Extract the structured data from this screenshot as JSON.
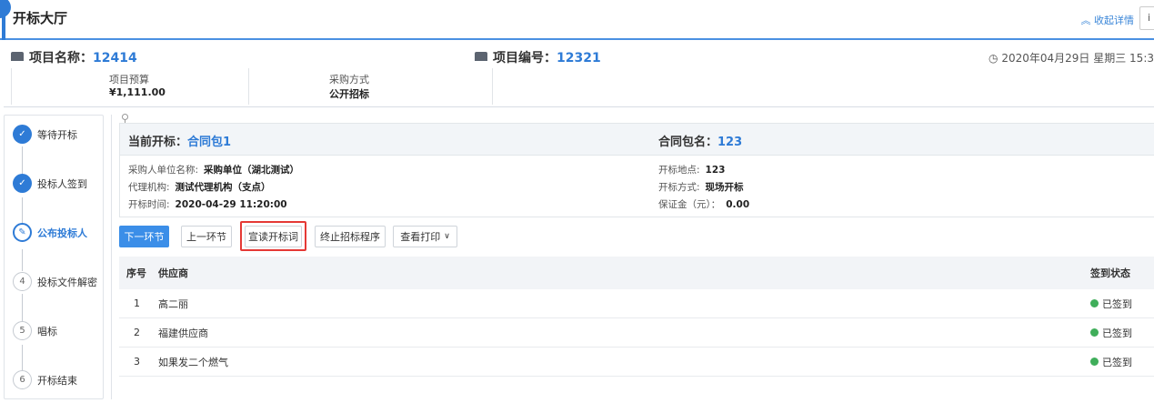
{
  "header": {
    "title": "开标大厅",
    "collapse_label": "收起详情",
    "collapse_icon": "chevron-up-icon",
    "right_button_label": "i"
  },
  "project": {
    "name_label": "项目名称：",
    "name_value": "12414",
    "code_label": "项目编号：",
    "code_value": "12321",
    "datetime": "2020年04月29日 星期三 15:3",
    "clock_icon": "clock-icon",
    "budget_label": "项目预算",
    "budget_value": "¥1,111.00",
    "method_label": "采购方式",
    "method_value": "公开招标"
  },
  "steps": [
    {
      "label": "等待开标",
      "state": "done",
      "marker": "✓"
    },
    {
      "label": "投标人签到",
      "state": "done",
      "marker": "✓"
    },
    {
      "label": "公布投标人",
      "state": "active",
      "marker": "✎"
    },
    {
      "label": "投标文件解密",
      "state": "todo",
      "marker": "4"
    },
    {
      "label": "唱标",
      "state": "todo",
      "marker": "5"
    },
    {
      "label": "开标结束",
      "state": "todo",
      "marker": "6"
    }
  ],
  "current": {
    "current_label": "当前开标：",
    "current_value": "合同包1",
    "package_label": "合同包名：",
    "package_value": "123",
    "purchaser_label": "采购人单位名称:",
    "purchaser_value": "采购单位（湖北测试）",
    "agency_label": "代理机构:",
    "agency_value": "测试代理机构（支点）",
    "time_label": "开标时间:",
    "time_value": "2020-04-29 11:20:00",
    "location_label": "开标地点:",
    "location_value": "123",
    "mode_label": "开标方式:",
    "mode_value": "现场开标",
    "deposit_label": "保证金（元）：",
    "deposit_value": "0.00"
  },
  "buttons": {
    "next": "下一环节",
    "prev": "上一环节",
    "read": "宣读开标词",
    "terminate": "终止招标程序",
    "print": "查看打印",
    "print_icon": "chevron-down-icon"
  },
  "table": {
    "headers": {
      "index": "序号",
      "supplier": "供应商",
      "status": "签到状态"
    },
    "rows": [
      {
        "index": "1",
        "supplier": "高二丽",
        "status": "已签到"
      },
      {
        "index": "2",
        "supplier": "福建供应商",
        "status": "已签到"
      },
      {
        "index": "3",
        "supplier": "如果发二个燃气",
        "status": "已签到"
      }
    ]
  },
  "colors": {
    "accent": "#2e7bd6",
    "primary_button": "#3b8ee8",
    "highlight_border": "#e53935",
    "status_green": "#3fae5a"
  }
}
